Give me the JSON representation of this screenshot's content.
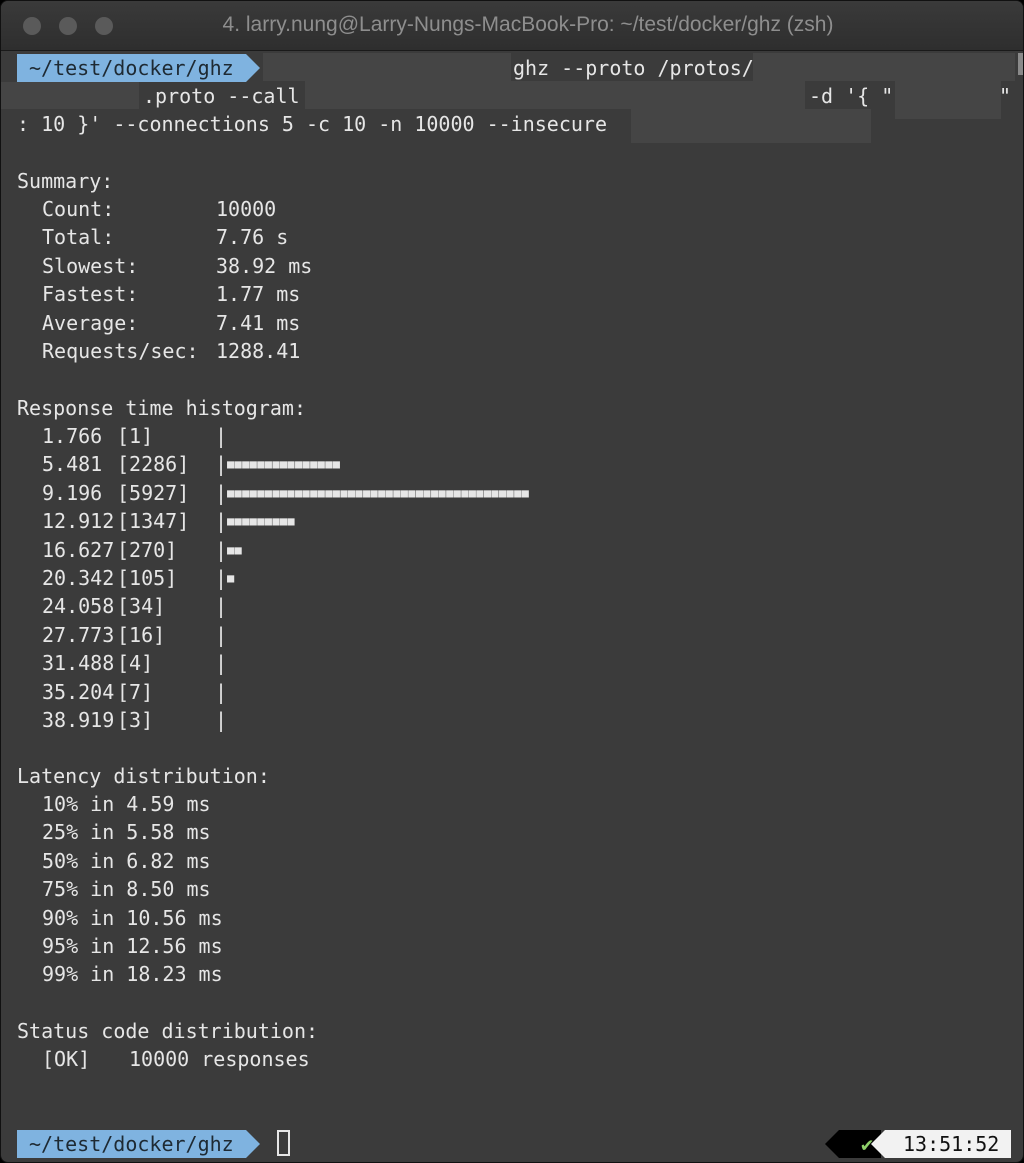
{
  "window": {
    "title": "4. larry.nung@Larry-Nungs-MacBook-Pro: ~/test/docker/ghz (zsh)"
  },
  "command": {
    "prompt_path": "~/test/docker/ghz",
    "segment1": "ghz --proto /protos/",
    "segment2": ".proto --call",
    "segment3": "-d '{ \"",
    "segment4": "\"",
    "segment5": ": 10 }' --connections 5 -c 10 -n 10000 --insecure"
  },
  "summary": {
    "heading": "Summary:",
    "rows": [
      {
        "label": "Count:",
        "value": "10000"
      },
      {
        "label": "Total:",
        "value": "7.76 s"
      },
      {
        "label": "Slowest:",
        "value": "38.92 ms"
      },
      {
        "label": "Fastest:",
        "value": "1.77 ms"
      },
      {
        "label": "Average:",
        "value": "7.41 ms"
      },
      {
        "label": "Requests/sec:",
        "value": "1288.41"
      }
    ]
  },
  "histogram": {
    "heading": "Response time histogram:",
    "rows": [
      {
        "bucket": "1.766",
        "count": "[1]",
        "blocks": ""
      },
      {
        "bucket": "5.481",
        "count": "[2286]",
        "blocks": "■■■■■■■■■■■■■■■"
      },
      {
        "bucket": "9.196",
        "count": "[5927]",
        "blocks": "■■■■■■■■■■■■■■■■■■■■■■■■■■■■■■■■■■■■■■■■"
      },
      {
        "bucket": "12.912",
        "count": "[1347]",
        "blocks": "■■■■■■■■■"
      },
      {
        "bucket": "16.627",
        "count": "[270]",
        "blocks": "■■"
      },
      {
        "bucket": "20.342",
        "count": "[105]",
        "blocks": "■"
      },
      {
        "bucket": "24.058",
        "count": "[34]",
        "blocks": ""
      },
      {
        "bucket": "27.773",
        "count": "[16]",
        "blocks": ""
      },
      {
        "bucket": "31.488",
        "count": "[4]",
        "blocks": ""
      },
      {
        "bucket": "35.204",
        "count": "[7]",
        "blocks": ""
      },
      {
        "bucket": "38.919",
        "count": "[3]",
        "blocks": ""
      }
    ]
  },
  "latency": {
    "heading": "Latency distribution:",
    "rows": [
      "10% in 4.59 ms",
      "25% in 5.58 ms",
      "50% in 6.82 ms",
      "75% in 8.50 ms",
      "90% in 10.56 ms",
      "95% in 12.56 ms",
      "99% in 18.23 ms"
    ]
  },
  "status": {
    "heading": "Status code distribution:",
    "rows": [
      {
        "code": "[OK]",
        "text": "10000 responses"
      }
    ]
  },
  "footer": {
    "prompt_path": "~/test/docker/ghz",
    "check": "✔",
    "time": "13:51:52"
  },
  "colors": {
    "background": "#3b3b3b",
    "prompt_bg": "#7fb3e0",
    "check": "#8fd16a"
  }
}
